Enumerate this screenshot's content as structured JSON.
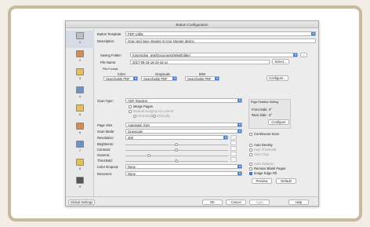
{
  "window_title": "Button Configuration",
  "sidebar": {
    "items": [
      {
        "num": "1"
      },
      {
        "num": "2"
      },
      {
        "num": "3"
      },
      {
        "num": "4"
      },
      {
        "num": "5"
      },
      {
        "num": "6"
      },
      {
        "num": "7"
      },
      {
        "num": "8"
      },
      {
        "num": "9"
      }
    ]
  },
  "general": {
    "template_label": "Button Template:",
    "template_value": "PDF Utility",
    "description_label": "Description:",
    "description_value": "Scan and save images to your storage device.",
    "folder_label": "Saving Folder:",
    "folder_value": "/Users/dep_test/Documents/Westfolder/",
    "folder_more": "...",
    "filename_label": "File Name:",
    "filename_value": "2017-09-19-18-24-42-xx",
    "select_label": "Select...",
    "file_format_heading": "File Format",
    "color_label": "Color",
    "grayscale_label": "Grayscale",
    "bw_label": "B/W",
    "color_value": "Searchable PDF",
    "grayscale_value": "Searchable PDF",
    "bw_value": "Searchable PDF",
    "configure_label": "Configure..."
  },
  "scan": {
    "scan_type_label": "Scan Type:",
    "scan_type_value": "ADF (Duplex)",
    "merge_label": "Merge Pages",
    "manual_label": "Manual merging not current",
    "horizontally_label": "Horizontally",
    "vertically_label": "Vertically",
    "page_size_label": "Page Size:",
    "page_size_value": "Automatic Size",
    "scan_mode_label": "Scan Mode:",
    "scan_mode_value": "Grayscale",
    "resolution_label": "Resolution:",
    "resolution_value": "300",
    "brightness_label": "Brightness:",
    "contrast_label": "Contrast:",
    "gamma_label": "Gamma:",
    "threshold_label": "Threshold:",
    "color_dropout_label": "Color Dropout:",
    "color_dropout_value": "None",
    "descreen_label": "Descreen:",
    "descreen_value": "None"
  },
  "right": {
    "group_title": "Page Rotation Setting",
    "front_label": "Front Side:",
    "front_value": "0°",
    "rear_label": "Rear Side:",
    "rear_value": "0°",
    "configure_label": "Configure",
    "continuous_label": "Continuous Scan",
    "auto_density_label": "Auto Density",
    "auto_threshold_label": "Auto Threshold",
    "auto_crop_label": "Auto Crop",
    "auto_deskew_label": "Auto Deskew",
    "remove_blank_label": "Remove Blank Pages",
    "image_edge_label": "Image Edge Fill",
    "preview_label": "Preview",
    "default_label": "Default"
  },
  "footer": {
    "global_label": "Global Settings",
    "ok_label": "OK",
    "cancel_label": "Cancel",
    "apply_label": "Apply",
    "help_label": "Help"
  },
  "colors": {
    "accent": "#3b82f6",
    "frame": "#c9b99d"
  }
}
